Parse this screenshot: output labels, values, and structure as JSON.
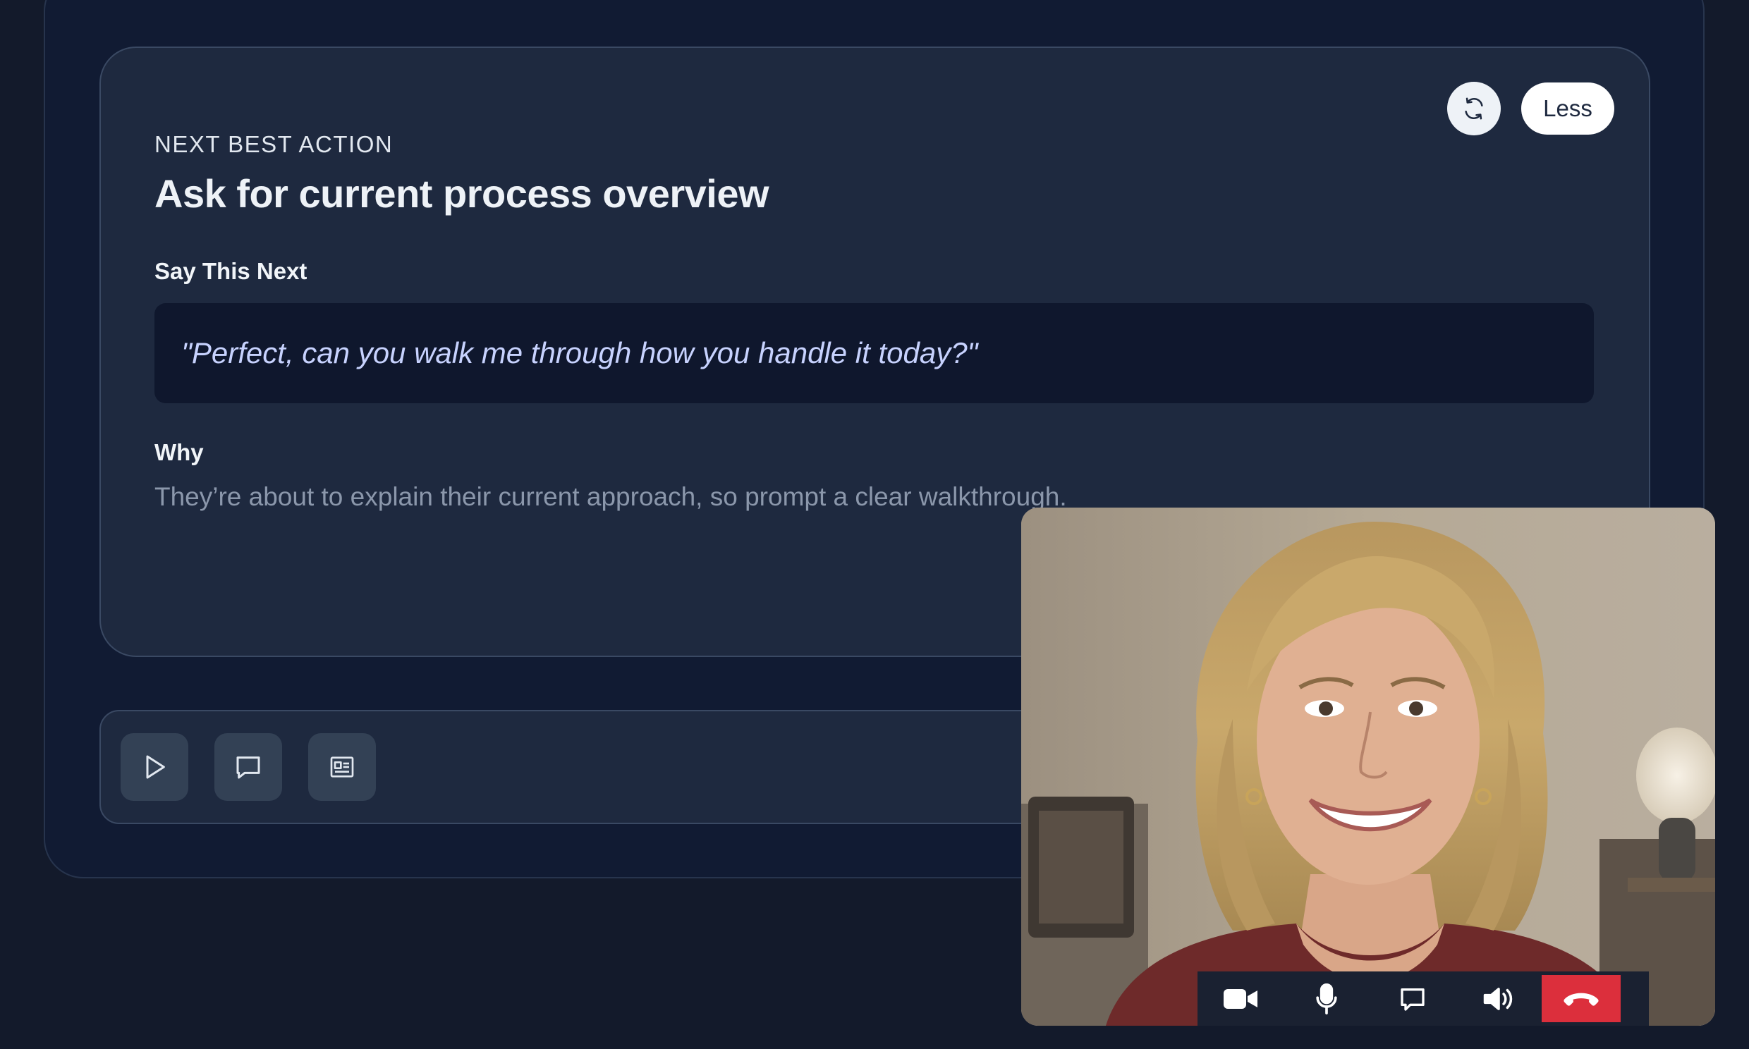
{
  "card": {
    "eyebrow": "NEXT BEST ACTION",
    "title": "Ask for current process overview",
    "say_label": "Say This Next",
    "say_text": "\"Perfect, can you walk me through how you handle it today?\"",
    "why_label": "Why",
    "why_text": "They’re about to explain their current approach, so prompt a clear walkthrough.",
    "less_label": "Less",
    "refresh_icon": "refresh-icon"
  },
  "toolbar": {
    "buttons": [
      {
        "icon": "play-icon"
      },
      {
        "icon": "chat-icon"
      },
      {
        "icon": "transcript-icon"
      }
    ]
  },
  "video_call": {
    "controls": [
      {
        "icon": "camera-icon"
      },
      {
        "icon": "microphone-icon"
      },
      {
        "icon": "screen-share-icon"
      },
      {
        "icon": "speaker-icon"
      },
      {
        "icon": "end-call-icon"
      }
    ],
    "colors": {
      "end_call": "#dc2f3c"
    }
  }
}
